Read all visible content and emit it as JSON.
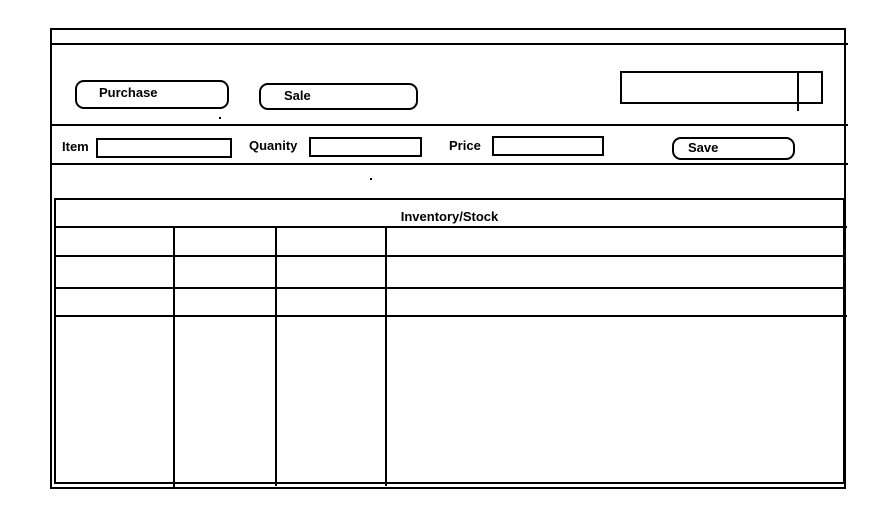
{
  "toolbar": {
    "purchase_label": "Purchase",
    "sale_label": "Sale",
    "search_value": ""
  },
  "form": {
    "item_label": "Item",
    "item_value": "",
    "quantity_label": "Quanity",
    "quantity_value": "",
    "price_label": "Price",
    "price_value": "",
    "save_label": "Save"
  },
  "inventory": {
    "title": "Inventory/Stock",
    "columns": 4,
    "rows": [
      [
        "",
        "",
        "",
        ""
      ],
      [
        "",
        "",
        "",
        ""
      ],
      [
        "",
        "",
        "",
        ""
      ],
      [
        "",
        "",
        "",
        ""
      ]
    ]
  }
}
